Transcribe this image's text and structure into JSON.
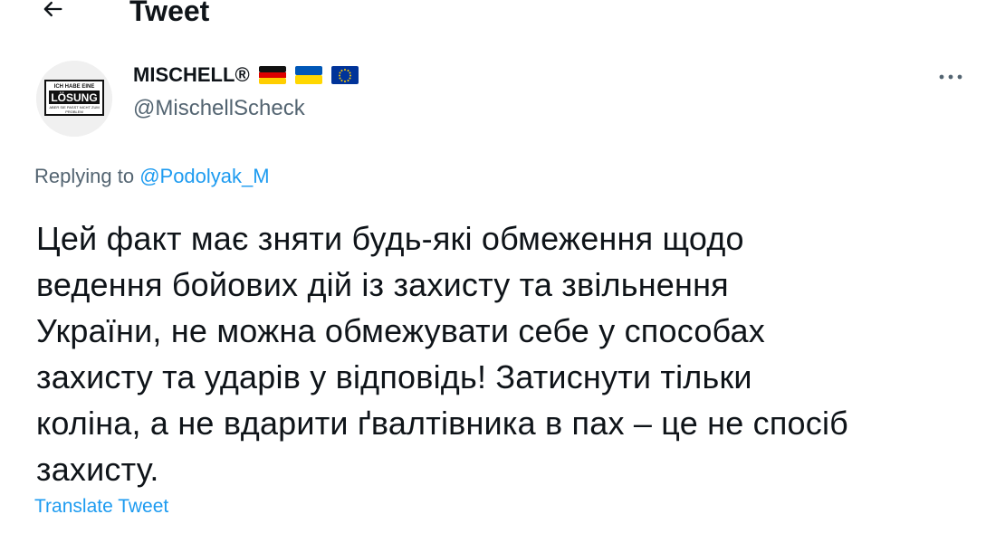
{
  "header": {
    "back_icon": "arrow-left-icon",
    "title": "Tweet"
  },
  "author": {
    "avatar_lines": [
      "ICH HABE EINE",
      "LÖSUNG",
      "ABER SIE PASST NICHT ZUM",
      "PROBLEM"
    ],
    "name": "MISCHELL®",
    "flags": [
      "germany-flag-icon",
      "ukraine-flag-icon",
      "eu-flag-icon"
    ],
    "handle": "@MischellScheck",
    "more_icon": "more-dots-icon"
  },
  "tweet": {
    "replying_prefix": "Replying to ",
    "replying_to": "@Podolyak_M",
    "text": "Цей факт має зняти будь-які обмеження щодо\nведення бойових дій із захисту та звільнення\nУкраїни, не можна обмежувати себе у способах\nзахисту та ударів у відповідь! Затиснути тільки\nколіна, а не вдарити ґвалтівника в пах – це не спосіб\nзахисту.",
    "translate_label": "Translate Tweet"
  },
  "colors": {
    "text": "#0f1419",
    "secondary": "#536471",
    "link": "#1d9bf0"
  }
}
